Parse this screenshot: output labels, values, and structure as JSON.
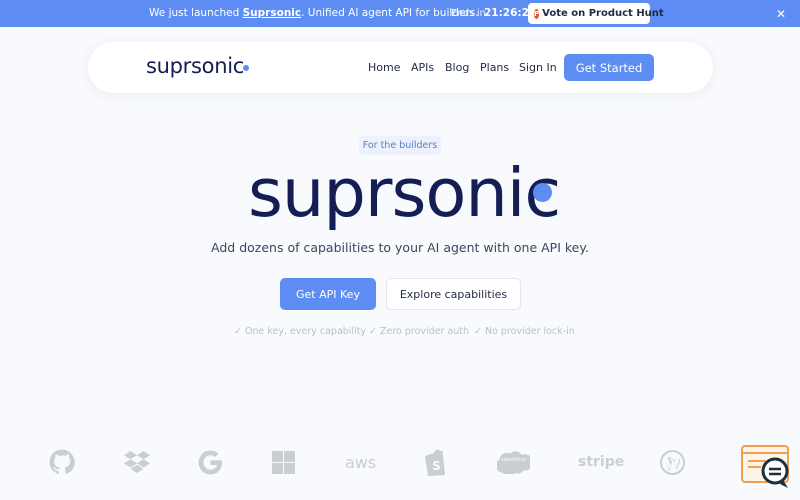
{
  "banner": {
    "prefix": "We just launched",
    "brand": "Suprsonic",
    "suffix": ". Unified AI agent API for builders.",
    "ends_label": "Ends in",
    "timer": "21:26:26",
    "cta_label": "Vote on Product Hunt",
    "cta_icon": "product-hunt-icon",
    "close_icon": "close-icon"
  },
  "nav": {
    "logo": "suprsonic",
    "links": [
      "Home",
      "APIs",
      "Blog",
      "Plans",
      "Sign In"
    ],
    "cta": "Get Started"
  },
  "hero": {
    "badge": "For the builders",
    "title": "suprsonic",
    "subtitle": "Add dozens of capabilities to your AI agent with one API key.",
    "primary_cta": "Get API Key",
    "secondary_cta": "Explore capabilities",
    "features": [
      "✓ One key, every capability",
      "✓ Zero provider auth",
      "✓ No provider lock-in"
    ]
  },
  "partners": {
    "logos": [
      "github-icon",
      "dropbox-icon",
      "google-icon",
      "microsoft-icon",
      "aws-icon",
      "shopify-icon",
      "salesforce-icon",
      "stripe-icon",
      "wordpress-icon"
    ],
    "aws": "aws",
    "salesforce": "salesforce",
    "stripe": "stripe"
  },
  "colors": {
    "accent": "#5d8df2",
    "brand_dark": "#141e55",
    "background": "#f8fafd",
    "chat_widget": "#f0a050"
  }
}
